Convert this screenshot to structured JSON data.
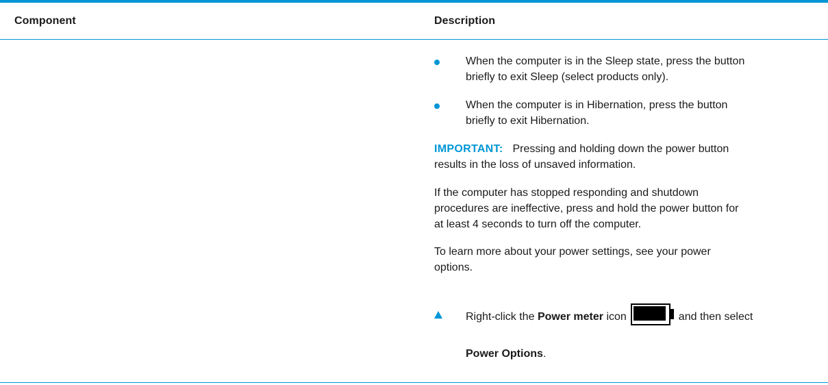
{
  "table": {
    "headers": {
      "component": "Component",
      "description": "Description"
    },
    "description": {
      "bullets": [
        {
          "line1": "When the computer is in the Sleep state, press the button",
          "line2": "briefly to exit Sleep (select products only)."
        },
        {
          "line1": "When the computer is in Hibernation, press the button",
          "line2": "briefly to exit Hibernation."
        }
      ],
      "important": {
        "label": "IMPORTANT:",
        "line1": "Pressing and holding down the power button",
        "line2": "results in the loss of unsaved information."
      },
      "shutdown_paragraph": {
        "line1": "If the computer has stopped responding and shutdown",
        "line2": "procedures are ineffective, press and hold the power button for",
        "line3": "at least 4 seconds to turn off the computer."
      },
      "settings_paragraph": {
        "line1": "To learn more about your power settings, see your power",
        "line2": "options."
      },
      "step": {
        "prefix": "Right-click the",
        "bold_term": "Power meter",
        "middle": "icon",
        "suffix": "and then select",
        "bold_option": "Power Options",
        "end": "."
      }
    }
  },
  "colors": {
    "accent": "#0096d6",
    "text": "#1a1a1a"
  },
  "icons": {
    "bullet": "bullet-dot-icon",
    "step": "triangle-step-icon",
    "battery": "battery-icon"
  }
}
